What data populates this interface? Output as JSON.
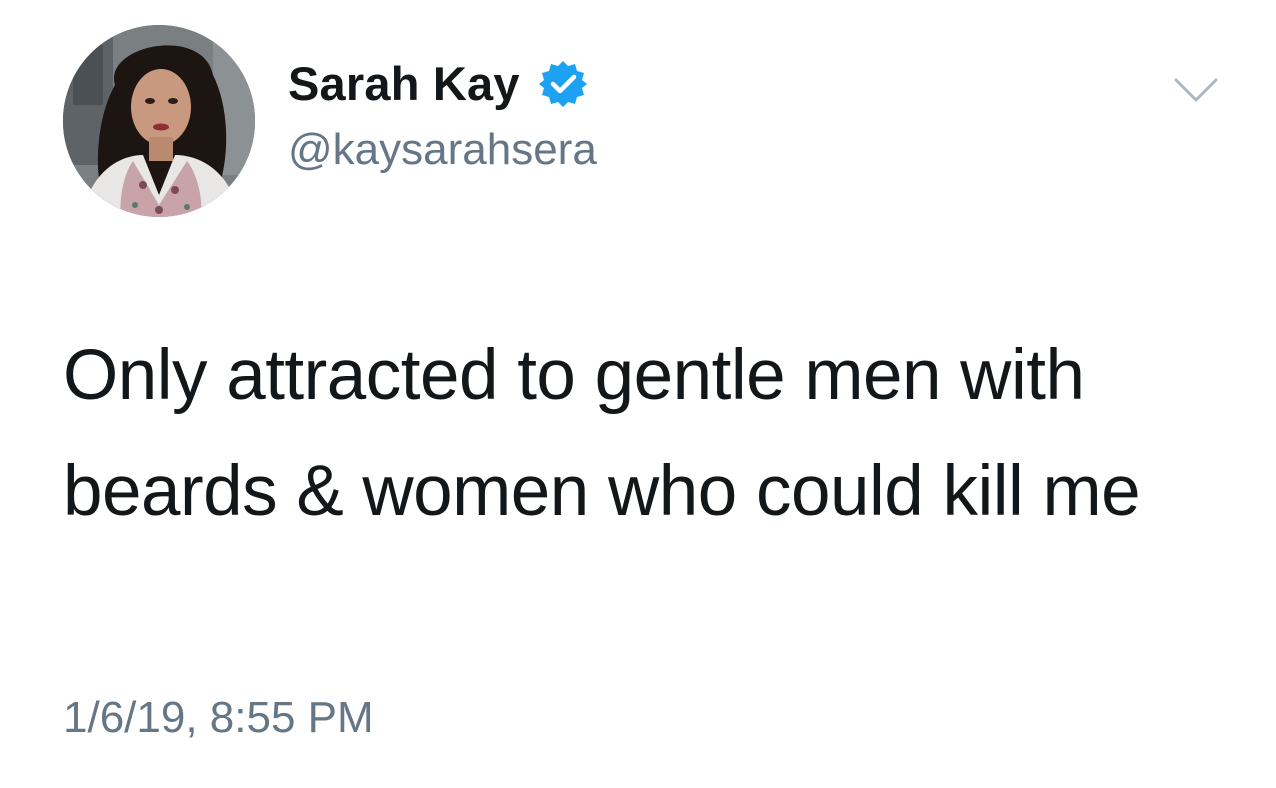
{
  "tweet": {
    "author": {
      "display_name": "Sarah Kay",
      "handle": "@kaysarahsera",
      "verified": true,
      "avatar_icon": "profile-photo"
    },
    "text": "Only attracted to gentle men with beards & women who could kill me",
    "timestamp": "1/6/19, 8:55 PM",
    "menu_icon": "chevron-down-icon"
  },
  "colors": {
    "text_primary": "#14171a",
    "text_secondary": "#657786",
    "verified_blue": "#1da1f2",
    "background": "#ffffff"
  }
}
